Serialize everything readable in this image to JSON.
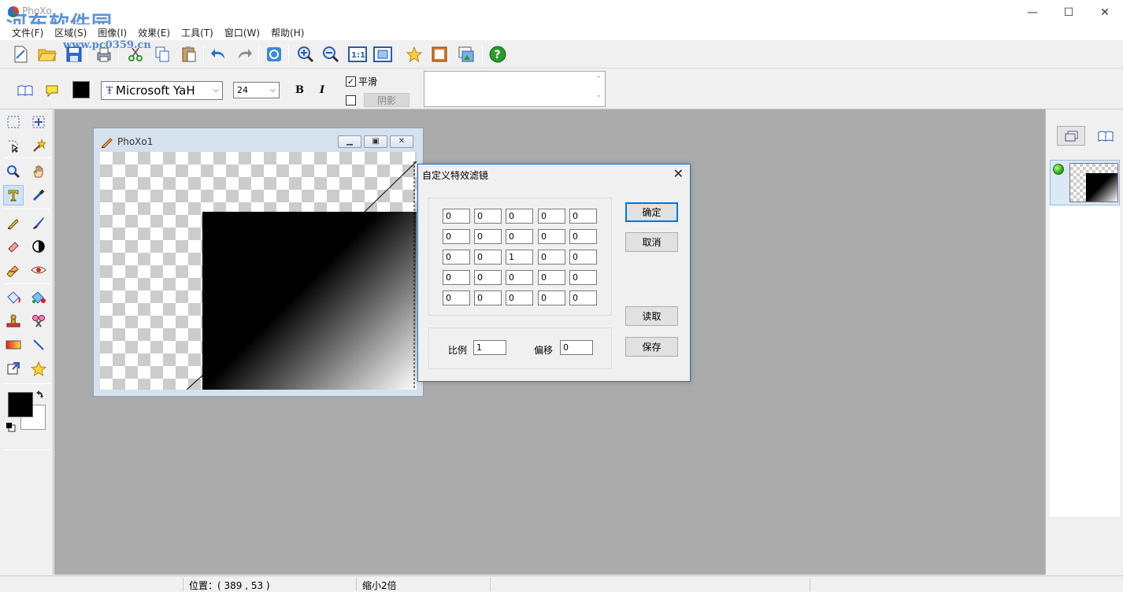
{
  "window": {
    "title": "PhoXo",
    "watermark": "河东软件园",
    "watermark_url": "www.pc0359.cn",
    "minimize": "—",
    "maximize": "☐",
    "close": "✕"
  },
  "menu": [
    "文件(F)",
    "区域(S)",
    "图像(I)",
    "效果(E)",
    "工具(T)",
    "窗口(W)",
    "帮助(H)"
  ],
  "textbar": {
    "font_name": "Microsoft YaH",
    "font_size": "24",
    "bold": "B",
    "italic": "I",
    "smooth_label": "平滑",
    "smooth_checked": "✓",
    "shadow_label": "阴影",
    "text_color": "#000000"
  },
  "image_window": {
    "title": "PhoXo1"
  },
  "dialog": {
    "title": "自定义特效滤镜",
    "matrix": [
      [
        "0",
        "0",
        "0",
        "0",
        "0"
      ],
      [
        "0",
        "0",
        "0",
        "0",
        "0"
      ],
      [
        "0",
        "0",
        "1",
        "0",
        "0"
      ],
      [
        "0",
        "0",
        "0",
        "0",
        "0"
      ],
      [
        "0",
        "0",
        "0",
        "0",
        "0"
      ]
    ],
    "scale_label": "比例",
    "scale_value": "1",
    "offset_label": "偏移",
    "offset_value": "0",
    "ok": "确定",
    "cancel": "取消",
    "load": "读取",
    "save": "保存"
  },
  "status": {
    "position": "位置：( 389 , 53 )",
    "zoom": "缩小2倍"
  },
  "colors": {
    "foreground": "#000000",
    "background": "#ffffff",
    "workspace": "#ababab",
    "accent": "#0078d7"
  }
}
